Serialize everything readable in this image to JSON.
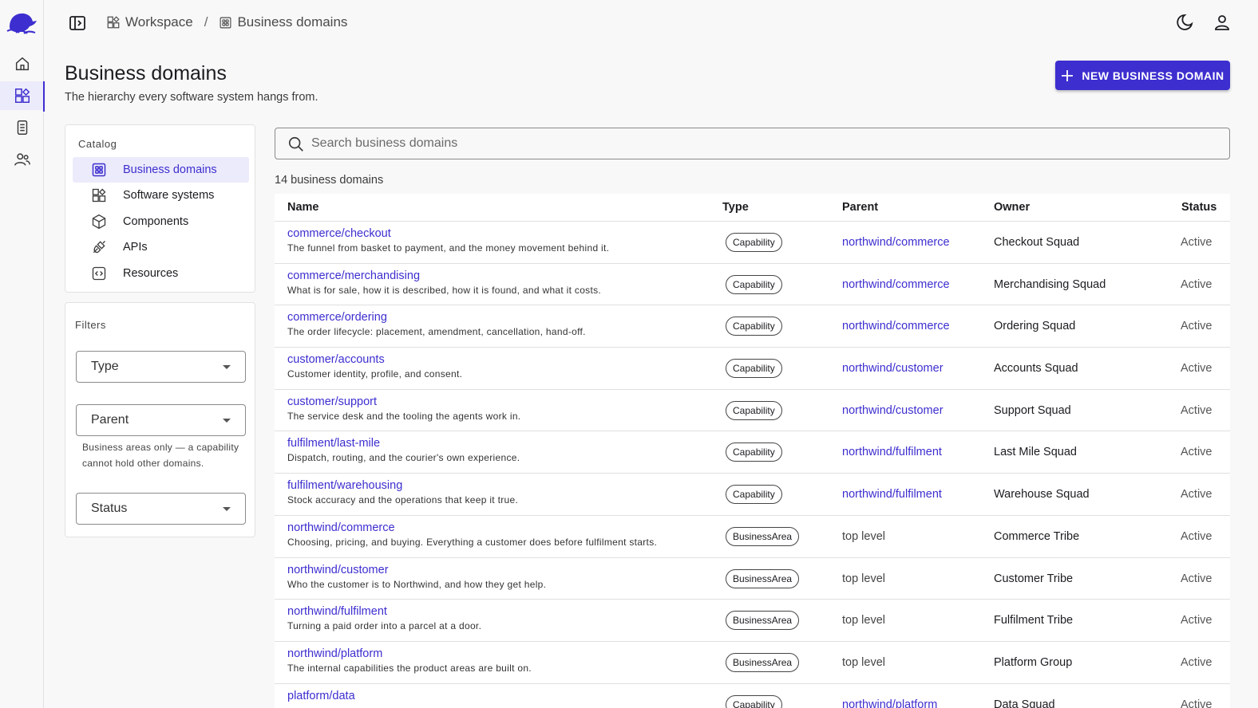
{
  "topbar": {
    "breadcrumbs": [
      {
        "label": "Workspace",
        "icon": "software-system-icon"
      },
      {
        "label": "Business domains",
        "icon": "business-domain-icon"
      }
    ],
    "separator": "/"
  },
  "header": {
    "title": "Business domains",
    "subtitle": "The hierarchy every software system hangs from.",
    "new_button": "NEW BUSINESS DOMAIN"
  },
  "catalog": {
    "label": "Catalog",
    "items": [
      {
        "label": "Business domains",
        "icon": "business-domain-icon",
        "active": true
      },
      {
        "label": "Software systems",
        "icon": "software-system-icon",
        "active": false
      },
      {
        "label": "Components",
        "icon": "component-cube-icon",
        "active": false
      },
      {
        "label": "APIs",
        "icon": "api-plug-icon",
        "active": false
      },
      {
        "label": "Resources",
        "icon": "resource-code-icon",
        "active": false
      }
    ]
  },
  "filters": {
    "label": "Filters",
    "type_label": "Type",
    "parent_label": "Parent",
    "parent_helper": "Business areas only — a capability cannot hold other domains.",
    "status_label": "Status"
  },
  "search": {
    "placeholder": "Search business domains"
  },
  "count_text": "14 business domains",
  "table": {
    "headers": {
      "name": "Name",
      "type": "Type",
      "parent": "Parent",
      "owner": "Owner",
      "status": "Status"
    },
    "rows": [
      {
        "name": "commerce/checkout",
        "desc": "The funnel from basket to payment, and the money movement behind it.",
        "type": "Capability",
        "parent": "northwind/commerce",
        "owner": "Checkout Squad",
        "status": "Active"
      },
      {
        "name": "commerce/merchandising",
        "desc": "What is for sale, how it is described, how it is found, and what it costs.",
        "type": "Capability",
        "parent": "northwind/commerce",
        "owner": "Merchandising Squad",
        "status": "Active"
      },
      {
        "name": "commerce/ordering",
        "desc": "The order lifecycle: placement, amendment, cancellation, hand-off.",
        "type": "Capability",
        "parent": "northwind/commerce",
        "owner": "Ordering Squad",
        "status": "Active"
      },
      {
        "name": "customer/accounts",
        "desc": "Customer identity, profile, and consent.",
        "type": "Capability",
        "parent": "northwind/customer",
        "owner": "Accounts Squad",
        "status": "Active"
      },
      {
        "name": "customer/support",
        "desc": "The service desk and the tooling the agents work in.",
        "type": "Capability",
        "parent": "northwind/customer",
        "owner": "Support Squad",
        "status": "Active"
      },
      {
        "name": "fulfilment/last-mile",
        "desc": "Dispatch, routing, and the courier's own experience.",
        "type": "Capability",
        "parent": "northwind/fulfilment",
        "owner": "Last Mile Squad",
        "status": "Active"
      },
      {
        "name": "fulfilment/warehousing",
        "desc": "Stock accuracy and the operations that keep it true.",
        "type": "Capability",
        "parent": "northwind/fulfilment",
        "owner": "Warehouse Squad",
        "status": "Active"
      },
      {
        "name": "northwind/commerce",
        "desc": "Choosing, pricing, and buying. Everything a customer does before fulfilment starts.",
        "type": "BusinessArea",
        "parent": "top level",
        "owner": "Commerce Tribe",
        "status": "Active"
      },
      {
        "name": "northwind/customer",
        "desc": "Who the customer is to Northwind, and how they get help.",
        "type": "BusinessArea",
        "parent": "top level",
        "owner": "Customer Tribe",
        "status": "Active"
      },
      {
        "name": "northwind/fulfilment",
        "desc": "Turning a paid order into a parcel at a door.",
        "type": "BusinessArea",
        "parent": "top level",
        "owner": "Fulfilment Tribe",
        "status": "Active"
      },
      {
        "name": "northwind/platform",
        "desc": "The internal capabilities the product areas are built on.",
        "type": "BusinessArea",
        "parent": "top level",
        "owner": "Platform Group",
        "status": "Active"
      },
      {
        "name": "platform/data",
        "desc": "",
        "type": "Capability",
        "parent": "northwind/platform",
        "owner": "Data Squad",
        "status": "Active"
      }
    ]
  },
  "colors": {
    "accent": "#3d2ecf",
    "active_bg": "#ecebfb"
  }
}
